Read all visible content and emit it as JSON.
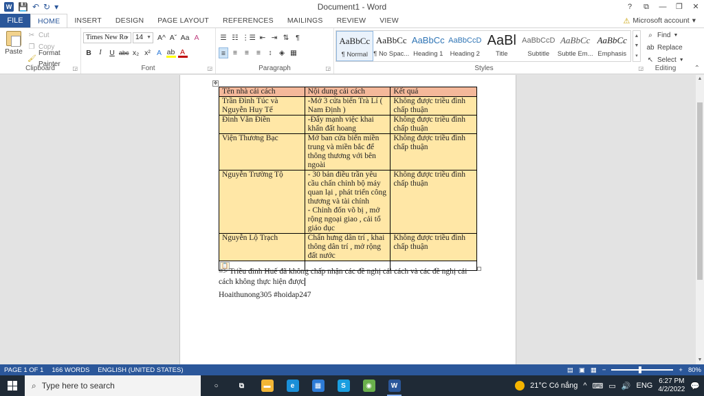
{
  "titlebar": {
    "title": "Document1 - Word",
    "qat": {
      "word_logo": "W",
      "save": "💾",
      "undo": "↶",
      "redo": "↻",
      "customize": "▾"
    },
    "controls": {
      "help": "?",
      "ribbon_display": "⧉",
      "minimize": "—",
      "restore": "❐",
      "close": "✕"
    }
  },
  "tabs": {
    "file": "FILE",
    "items": [
      "HOME",
      "INSERT",
      "DESIGN",
      "PAGE LAYOUT",
      "REFERENCES",
      "MAILINGS",
      "REVIEW",
      "VIEW"
    ],
    "account": "Microsoft account",
    "account_warning": "⚠"
  },
  "ribbon": {
    "clipboard": {
      "label": "Clipboard",
      "paste": "Paste",
      "cut": "Cut",
      "copy": "Copy",
      "format_painter": "Format Painter"
    },
    "font": {
      "label": "Font",
      "font_name": "Times New Ro",
      "font_size": "14",
      "grow": "A^",
      "shrink": "Aˇ",
      "change_case": "Aa",
      "clear": "A",
      "bold": "B",
      "italic": "I",
      "underline": "U",
      "strike": "abc",
      "subscript": "x₂",
      "superscript": "x²",
      "effects": "A",
      "highlight": "ab",
      "color": "A"
    },
    "paragraph": {
      "label": "Paragraph",
      "bullets": "☰",
      "numbering": "☷",
      "multilevel": "⋮☰",
      "decrease_indent": "⇤",
      "increase_indent": "⇥",
      "sort": "⇅",
      "show_marks": "¶",
      "align_left": "≡",
      "center": "≡",
      "align_right": "≡",
      "justify": "≡",
      "line_spacing": "↕",
      "shading": "◈",
      "borders": "▦"
    },
    "styles": {
      "label": "Styles",
      "items": [
        {
          "sample": "AaBbCc",
          "name": "¶ Normal",
          "active": true
        },
        {
          "sample": "AaBbCc",
          "name": "¶ No Spac..."
        },
        {
          "sample": "AaBbCc",
          "name": "Heading 1"
        },
        {
          "sample": "AaBbCcD",
          "name": "Heading 2"
        },
        {
          "sample": "AaBl",
          "name": "Title"
        },
        {
          "sample": "AaBbCcD",
          "name": "Subtitle"
        },
        {
          "sample": "AaBbCc",
          "name": "Subtle Em..."
        },
        {
          "sample": "AaBbCc",
          "name": "Emphasis"
        }
      ]
    },
    "editing": {
      "label": "Editing",
      "find": "Find",
      "replace": "Replace",
      "select": "Select"
    },
    "collapse": "⌃"
  },
  "table": {
    "headers": [
      "Tên nhà cải cách",
      "Nội dung cải cách",
      "Kết quả"
    ],
    "rows": [
      [
        "Trần Đình Túc và Nguyễn Huy Tế",
        "-Mở 3 cửa biển Trà Lí ( Nam Định )",
        "Không được triều đình chấp thuận"
      ],
      [
        "Đinh Văn Điền",
        "-Đẩy mạnh việc khai khẩn đất hoang",
        "Không được triều đình chấp thuận"
      ],
      [
        "Viện Thương Bạc",
        "Mở ban cửa biển miền trung và miền bắc để thông thương với bên ngoài",
        "Không được triều đình chấp thuận"
      ],
      [
        "Nguyễn Trường Tộ",
        "- 30 bản điều trần yêu cầu chấn chỉnh bộ máy quan lại , phát triển công thương và tài chính\n- Chỉnh đốn võ bị , mở rộng ngoại giao , cải tổ giáo dục",
        "Không được triều đình chấp thuận"
      ],
      [
        "Nguyễn Lộ Trạch",
        "Chấn hưng dân trí , khai thông dân trí , mở rộng đất nước",
        "Không được triều đình chấp thuận"
      ]
    ],
    "move_handle": "✥",
    "paste_options": "📋"
  },
  "document": {
    "conclusion": "=> Triều đình Huế đã không chấp nhận các đề nghị cải cách và các đề nghị cải cách không thực hiện được",
    "signature": "Hoaithunong305 #hoidap247"
  },
  "statusbar": {
    "page": "PAGE 1 OF 1",
    "words": "166 WORDS",
    "language": "ENGLISH (UNITED STATES)",
    "zoom": "80%",
    "zoom_level": 0.8,
    "zoom_minus": "−",
    "zoom_plus": "+",
    "view_read": "▤",
    "view_print": "▣",
    "view_web": "▦"
  },
  "taskbar": {
    "search_placeholder": "Type here to search",
    "weather": "21°C Có nắng",
    "language": "ENG",
    "time": "6:27 PM",
    "date": "4/2/2022",
    "apps": [
      {
        "name": "cortana",
        "glyph": "○",
        "color": "#1f2a36"
      },
      {
        "name": "task-view",
        "glyph": "⧉",
        "color": "#1f2a36"
      },
      {
        "name": "file-explorer",
        "glyph": "▬",
        "color": "#f2b636"
      },
      {
        "name": "edge",
        "glyph": "e",
        "color": "#1a8fd8"
      },
      {
        "name": "store",
        "glyph": "▦",
        "color": "#2d7bd6"
      },
      {
        "name": "skype",
        "glyph": "S",
        "color": "#1a9ee0"
      },
      {
        "name": "chrome",
        "glyph": "◉",
        "color": "#6ab04c"
      },
      {
        "name": "word",
        "glyph": "W",
        "color": "#2b579a",
        "active": true
      }
    ],
    "tray_icons": [
      "^",
      "⌨",
      "▭",
      "🔊",
      "💬"
    ]
  }
}
